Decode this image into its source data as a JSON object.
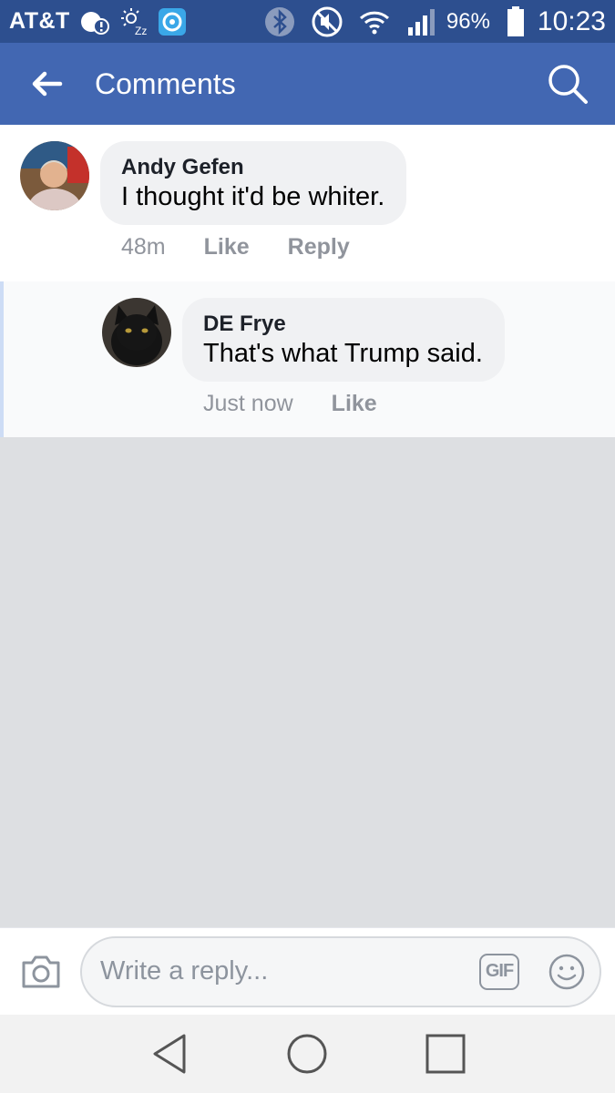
{
  "status_bar": {
    "carrier": "AT&T",
    "battery_percent": "96%",
    "time": "10:23",
    "icons": [
      "notification-icon",
      "sleep-icon",
      "app-icon",
      "bluetooth-icon",
      "mute-icon",
      "wifi-icon",
      "signal-icon",
      "battery-icon"
    ]
  },
  "header": {
    "title": "Comments",
    "back_icon": "arrow-left-icon",
    "search_icon": "search-icon",
    "color": "#4267b2"
  },
  "comments": [
    {
      "author": "Andy Gefen",
      "text": "I thought it'd be whiter.",
      "time": "48m",
      "like_label": "Like",
      "reply_label": "Reply"
    }
  ],
  "replies": [
    {
      "author": "DE Frye",
      "text": "That's what Trump said.",
      "time": "Just now",
      "like_label": "Like"
    }
  ],
  "composer": {
    "placeholder": "Write a reply...",
    "gif_label": "GIF",
    "camera_icon": "camera-icon",
    "emoji_icon": "emoji-icon"
  },
  "nav_bar": {
    "icons": [
      "back-triangle-icon",
      "home-circle-icon",
      "recents-square-icon"
    ]
  }
}
